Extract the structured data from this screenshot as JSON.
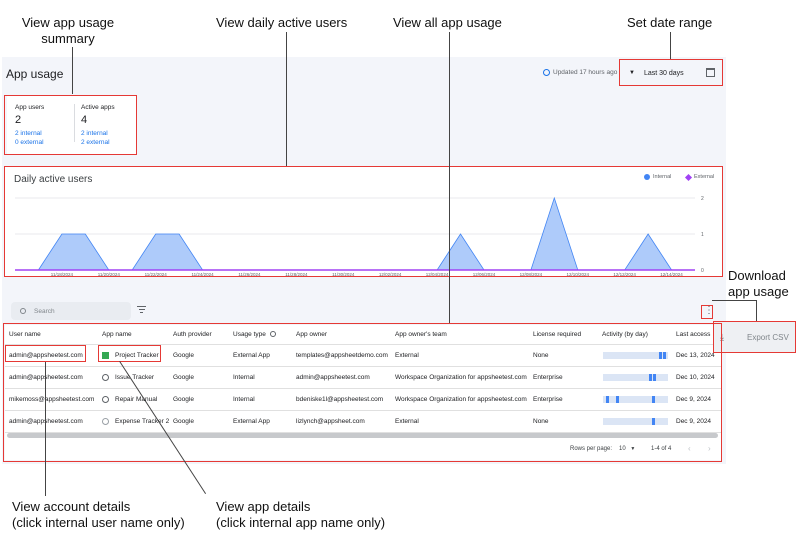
{
  "annotations": {
    "summary": "View app usage\nsummary",
    "daily": "View daily active users",
    "all_usage": "View all app usage",
    "date_range": "Set date range",
    "download": "Download\napp usage",
    "account": "View account details\n(click internal user name only)",
    "app_details": "View app details\n(click internal app name only)"
  },
  "page": {
    "title": "App usage",
    "updated": "Updated 17 hours ago"
  },
  "date_range": {
    "value": "Last 30 days"
  },
  "summary": {
    "app_users": {
      "label": "App users",
      "count": "2",
      "internal": "2 internal",
      "external": "0 external"
    },
    "active_apps": {
      "label": "Active apps",
      "count": "4",
      "internal": "2 internal",
      "external": "2 external"
    }
  },
  "chart": {
    "title": "Daily active users",
    "legend_internal": "Internal",
    "legend_external": "External",
    "colors": {
      "internal": "#4285f4",
      "internal_fill": "#aecbfa",
      "external": "#a142f4"
    }
  },
  "chart_data": {
    "type": "area",
    "title": "Daily active users",
    "x_ticks": [
      "11/18/2024",
      "11/20/2024",
      "11/22/2024",
      "11/24/2024",
      "11/26/2024",
      "11/28/2024",
      "11/30/2024",
      "12/02/2024",
      "12/04/2024",
      "12/06/2024",
      "12/08/2024",
      "12/10/2024",
      "12/12/2024",
      "12/14/2024"
    ],
    "y_ticks": [
      "0",
      "1",
      "2"
    ],
    "ylim": [
      0,
      2
    ],
    "grid": true,
    "legend": "top-right",
    "series": [
      {
        "name": "Internal",
        "x": [
          "11/17/2024",
          "11/18/2024",
          "11/19/2024",
          "11/20/2024",
          "11/21/2024",
          "11/22/2024",
          "11/23/2024",
          "11/24/2024",
          "11/25/2024",
          "12/04/2024",
          "12/05/2024",
          "12/06/2024",
          "12/07/2024",
          "12/08/2024",
          "12/09/2024",
          "12/10/2024",
          "12/11/2024",
          "12/12/2024",
          "12/13/2024",
          "12/14/2024"
        ],
        "values": [
          0,
          1,
          1,
          0,
          0,
          1,
          1,
          0,
          0,
          0,
          1,
          0,
          0,
          0,
          2,
          0,
          0,
          0,
          1,
          0
        ]
      },
      {
        "name": "External",
        "x": [
          "11/16/2024",
          "12/15/2024"
        ],
        "values": [
          0,
          0
        ]
      }
    ]
  },
  "search": {
    "placeholder": "Search"
  },
  "table": {
    "headers": [
      "User name",
      "App name",
      "Auth provider",
      "Usage type",
      "App owner",
      "App owner's team",
      "License required",
      "Activity (by day)",
      "Last access"
    ],
    "rows": [
      {
        "user": "admin@appsheetest.com",
        "app": "Project Tracker",
        "auth": "Google",
        "usage": "External App",
        "owner": "templates@appsheetdemo.com",
        "team": "External",
        "license": "None",
        "last": "Dec 13, 2024",
        "activity": [
          0.86,
          0.93
        ]
      },
      {
        "user": "admin@appsheetest.com",
        "app": "Issue Tracker",
        "auth": "Google",
        "usage": "Internal",
        "owner": "admin@appsheetest.com",
        "team": "Workspace Organization for appsheetest.com",
        "license": "Enterprise",
        "last": "Dec 10, 2024",
        "activity": [
          0.7,
          0.77
        ]
      },
      {
        "user": "mikemoss@appsheetest.com",
        "app": "Repair Manual",
        "auth": "Google",
        "usage": "Internal",
        "owner": "bdeniske1l@appsheetest.com",
        "team": "Workspace Organization for appsheetest.com",
        "license": "Enterprise",
        "last": "Dec 9, 2024",
        "activity": [
          0.04,
          0.2,
          0.76
        ]
      },
      {
        "user": "admin@appsheetest.com",
        "app": "Expense Tracker 2",
        "auth": "Google",
        "usage": "External App",
        "owner": "lizlynch@appsheet.com",
        "team": "External",
        "license": "None",
        "last": "Dec 9, 2024",
        "activity": [
          0.76
        ]
      }
    ]
  },
  "pager": {
    "rows_label": "Rows per page:",
    "rows_value": "10",
    "range": "1-4 of 4"
  },
  "export": {
    "label": "Export CSV"
  }
}
